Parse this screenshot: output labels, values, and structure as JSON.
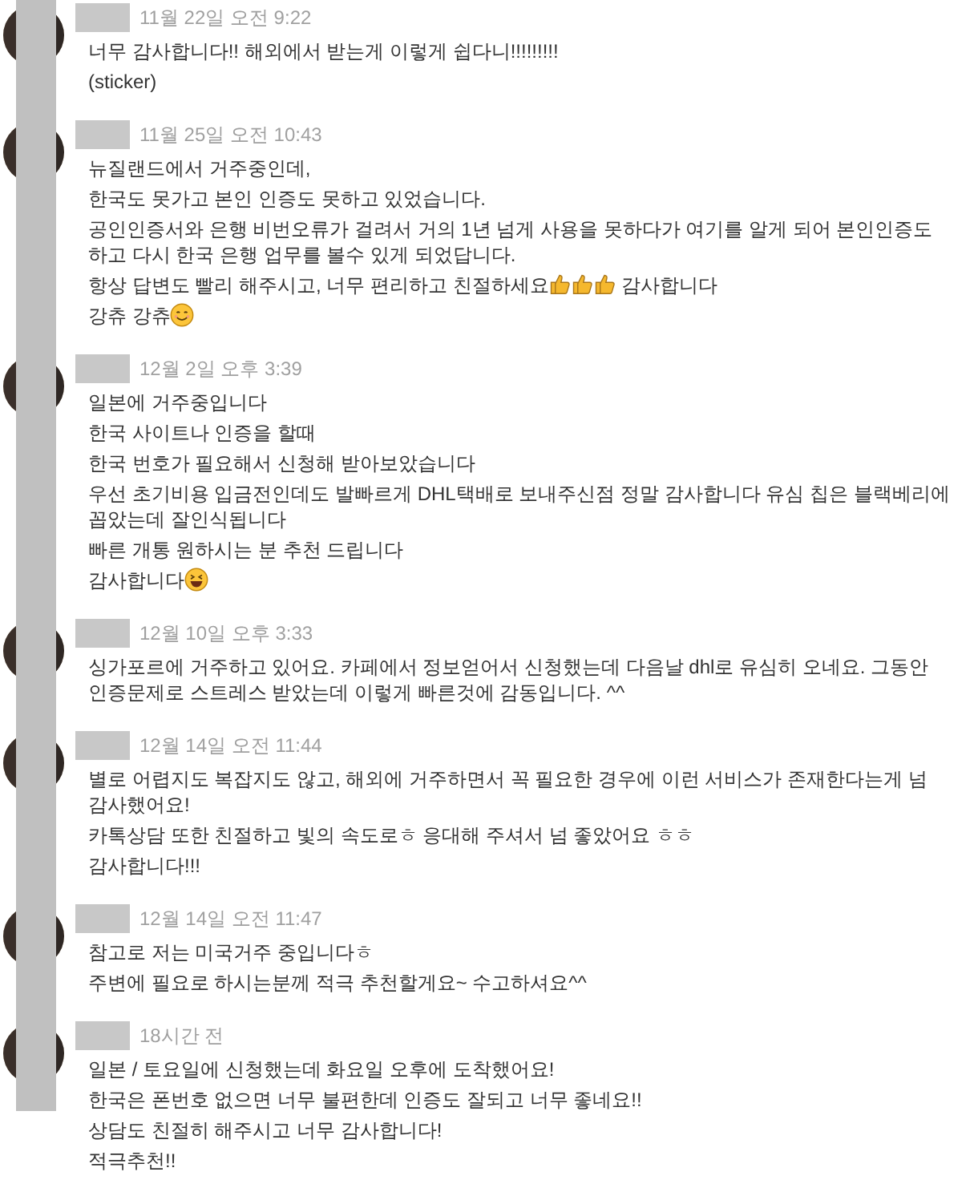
{
  "comments": [
    {
      "time": "11월 22일 오전 9:22",
      "lines": [
        [
          {
            "text": "너무 감사합니다!! 해외에서 받는게 이렇게 쉽다니!!!!!!!!!"
          }
        ],
        [
          {
            "text": "(sticker)"
          }
        ]
      ]
    },
    {
      "time": "11월 25일 오전 10:43",
      "lines": [
        [
          {
            "text": "뉴질랜드에서 거주중인데,"
          }
        ],
        [
          {
            "text": "한국도 못가고 본인 인증도 못하고 있었습니다."
          }
        ],
        [
          {
            "text": "공인인증서와 은행 비번오류가 걸려서 거의 1년 넘게 사용을 못하다가 여기를 알게 되어 본인인증도 하고 다시 한국 은행 업무를 볼수 있게 되었답니다."
          }
        ],
        [
          {
            "text": "항상 답변도 빨리 해주시고, 너무 편리하고 친절하세요"
          },
          {
            "kind": "thumbs_up"
          },
          {
            "kind": "thumbs_up"
          },
          {
            "kind": "thumbs_up"
          },
          {
            "text": " 감사합니다"
          }
        ],
        [
          {
            "text": "강츄 강츄"
          },
          {
            "kind": "smile"
          }
        ]
      ]
    },
    {
      "time": "12월 2일 오후 3:39",
      "lines": [
        [
          {
            "text": "일본에 거주중입니다"
          }
        ],
        [
          {
            "text": "한국 사이트나 인증을 할때"
          }
        ],
        [
          {
            "text": "한국 번호가 필요해서 신청해 받아보았습니다"
          }
        ],
        [
          {
            "text": "우선 초기비용 입금전인데도 발빠르게 DHL택배로 보내주신점 정말 감사합니다 유심 칩은 블랙베리에 꼽았는데 잘인식됩니다"
          }
        ],
        [
          {
            "text": "빠른 개통 원하시는 분 추천 드립니다"
          }
        ],
        [
          {
            "text": "감사합니다"
          },
          {
            "kind": "grin"
          }
        ]
      ]
    },
    {
      "time": "12월 10일 오후 3:33",
      "lines": [
        [
          {
            "text": "싱가포르에 거주하고 있어요. 카페에서 정보얻어서 신청했는데 다음날 dhl로 유심히 오네요. 그동안 인증문제로 스트레스 받았는데 이렇게 빠른것에 감동입니다. ^^"
          }
        ]
      ]
    },
    {
      "time": "12월 14일 오전 11:44",
      "lines": [
        [
          {
            "text": "별로 어렵지도 복잡지도 않고, 해외에 거주하면서 꼭 필요한 경우에 이런 서비스가 존재한다는게 넘 감사했어요!"
          }
        ],
        [
          {
            "text": "카톡상담 또한 친절하고 빛의 속도로ㅎ 응대해 주셔서 넘 좋았어요 ㅎㅎ"
          }
        ],
        [
          {
            "text": "감사합니다!!!"
          }
        ]
      ]
    },
    {
      "time": "12월 14일 오전 11:47",
      "lines": [
        [
          {
            "text": "참고로 저는 미국거주 중입니다ㅎ"
          }
        ],
        [
          {
            "text": "주변에 필요로 하시는분께 적극 추천할게요~ 수고하셔요^^"
          }
        ]
      ]
    },
    {
      "time": "18시간 전",
      "lines": [
        [
          {
            "text": "일본 / 토요일에 신청했는데 화요일 오후에 도착했어요!"
          }
        ],
        [
          {
            "text": "한국은 폰번호 없으면 너무 불편한데 인증도 잘되고 너무 좋네요!!"
          }
        ],
        [
          {
            "text": "상담도 친절히 해주시고 너무 감사합니다!"
          }
        ],
        [
          {
            "text": "적극추천!!"
          }
        ]
      ]
    }
  ]
}
